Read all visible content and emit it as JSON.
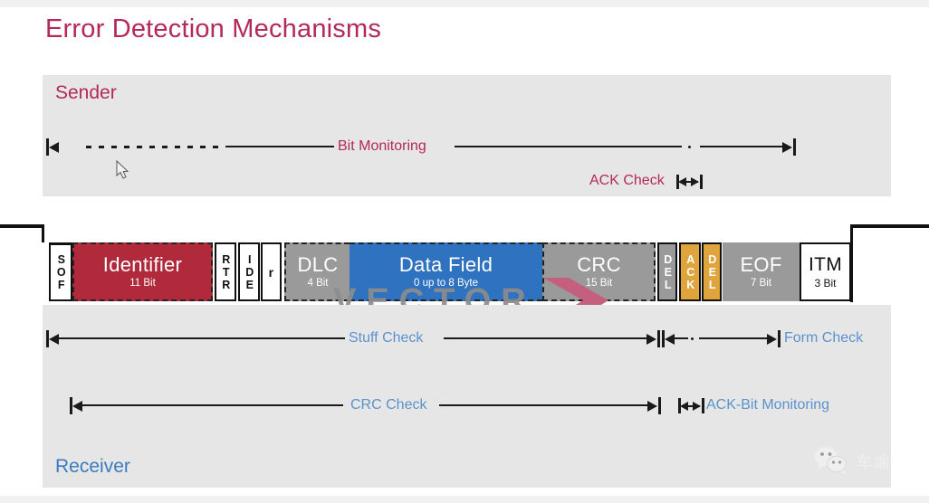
{
  "slide": {
    "title": "Error Detection Mechanisms"
  },
  "sender": {
    "label": "Sender",
    "checks": [
      {
        "name": "Bit Monitoring",
        "color": "#b4285a"
      },
      {
        "name": "ACK Check",
        "color": "#b4285a"
      }
    ]
  },
  "receiver": {
    "label": "Receiver",
    "checks": [
      {
        "name": "Stuff Check",
        "color": "#5b93cd"
      },
      {
        "name": "Form Check",
        "color": "#5b93cd"
      },
      {
        "name": "CRC Check",
        "color": "#5b93cd"
      },
      {
        "name": "ACK-Bit Monitoring",
        "color": "#5b93cd"
      }
    ]
  },
  "frame": {
    "fields": [
      {
        "name": "SOF",
        "bits": "",
        "color": "#ffffff"
      },
      {
        "name": "Identifier",
        "bits": "11 Bit",
        "color": "#b02a3c"
      },
      {
        "name": "RTR",
        "bits": "",
        "color": "#ffffff"
      },
      {
        "name": "IDE",
        "bits": "",
        "color": "#ffffff"
      },
      {
        "name": "r",
        "bits": "",
        "color": "#ffffff"
      },
      {
        "name": "DLC",
        "bits": "4 Bit",
        "color": "#9a9a9a"
      },
      {
        "name": "Data Field",
        "bits": "0 up to 8 Byte",
        "color": "#2f72c0"
      },
      {
        "name": "CRC",
        "bits": "15 Bit",
        "color": "#9a9a9a"
      },
      {
        "name": "DEL",
        "bits": "",
        "color": "#9a9a9a"
      },
      {
        "name": "ACK",
        "bits": "",
        "color": "#e0a43c"
      },
      {
        "name": "DEL",
        "bits": "",
        "color": "#e0a43c"
      },
      {
        "name": "EOF",
        "bits": "7 Bit",
        "color": "#9a9a9a"
      },
      {
        "name": "ITM",
        "bits": "3 Bit",
        "color": "#ffffff"
      }
    ]
  },
  "watermark": {
    "text": "VECTOR",
    "chevron_color": "#c4607e",
    "text_color": "#8d8d8d"
  },
  "wechat": {
    "text": "车端"
  }
}
